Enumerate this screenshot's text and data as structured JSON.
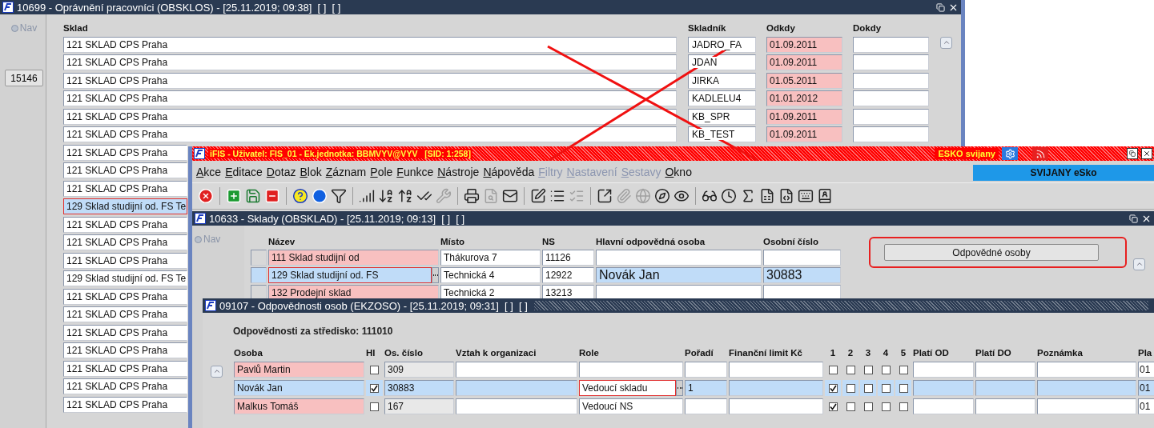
{
  "back_window": {
    "title": "10699 - Oprávnění pracovníci (OBSKLOS) - [25.11.2019; 09:38]  [ ]  [ ]",
    "nav": {
      "label": "Nav",
      "selected": false
    },
    "record_number": "15146",
    "columns": [
      "Sklad",
      "Skladník",
      "Odkdy",
      "Dokdy"
    ],
    "rows": [
      {
        "sklad": "121 SKLAD CPS Praha",
        "skladnik": "JADRO_FA",
        "odkdy": "01.09.2011",
        "selected": false
      },
      {
        "sklad": "121 SKLAD CPS Praha",
        "skladnik": "JDAN",
        "odkdy": "01.09.2011",
        "selected": false
      },
      {
        "sklad": "121 SKLAD CPS Praha",
        "skladnik": "JIRKA",
        "odkdy": "01.05.2011",
        "selected": false
      },
      {
        "sklad": "121 SKLAD CPS Praha",
        "skladnik": "KADLELU4",
        "odkdy": "01.01.2012",
        "selected": false
      },
      {
        "sklad": "121 SKLAD CPS Praha",
        "skladnik": "KB_SPR",
        "odkdy": "01.09.2011",
        "selected": false
      },
      {
        "sklad": "121 SKLAD CPS Praha",
        "skladnik": "KB_TEST",
        "odkdy": "01.09.2011",
        "selected": false
      },
      {
        "sklad": "121 SKLAD CPS Praha",
        "selected": false
      },
      {
        "sklad": "121 SKLAD CPS Praha",
        "selected": false
      },
      {
        "sklad": "121 SKLAD CPS Praha",
        "selected": false
      },
      {
        "sklad": "129 Sklad studijní od. FS Te",
        "selected": true
      },
      {
        "sklad": "121 SKLAD CPS Praha",
        "selected": false
      },
      {
        "sklad": "121 SKLAD CPS Praha",
        "selected": false
      },
      {
        "sklad": "121 SKLAD CPS Praha",
        "selected": false
      },
      {
        "sklad": "129 Sklad studijní od. FS Te",
        "selected": false
      },
      {
        "sklad": "121 SKLAD CPS Praha",
        "selected": false
      },
      {
        "sklad": "121 SKLAD CPS Praha",
        "selected": false
      },
      {
        "sklad": "121 SKLAD CPS Praha",
        "selected": false
      },
      {
        "sklad": "121 SKLAD CPS Praha",
        "selected": false
      },
      {
        "sklad": "121 SKLAD CPS Praha",
        "selected": false
      },
      {
        "sklad": "121 SKLAD CPS Praha",
        "selected": false
      },
      {
        "sklad": "121 SKLAD CPS Praha",
        "selected": false
      }
    ]
  },
  "main_window": {
    "title": "iFIS - Uživatel: FIS_01 - Ek.jednotka: BBMVYV@VYV   [SID: 1:258]",
    "badge": "ESKO svijany",
    "menu": [
      {
        "label": "Akce",
        "disabled": false
      },
      {
        "label": "Editace",
        "disabled": false
      },
      {
        "label": "Dotaz",
        "disabled": false
      },
      {
        "label": "Blok",
        "disabled": false
      },
      {
        "label": "Záznam",
        "disabled": false
      },
      {
        "label": "Pole",
        "disabled": false
      },
      {
        "label": "Funkce",
        "disabled": false
      },
      {
        "label": "Nástroje",
        "disabled": false
      },
      {
        "label": "Nápověda",
        "disabled": false
      },
      {
        "label": "Filtry",
        "disabled": true
      },
      {
        "label": "Nastavení",
        "disabled": true
      },
      {
        "label": "Sestavy",
        "disabled": true
      },
      {
        "label": "Okno",
        "disabled": false
      }
    ],
    "company": "SVIJANY eSko",
    "toolbar": [
      [
        {
          "disabled": false
        }
      ],
      [
        {
          "disabled": false
        },
        {
          "disabled": false
        },
        {
          "disabled": false
        }
      ],
      [
        {
          "disabled": false
        },
        {
          "disabled": false
        },
        {
          "disabled": false
        }
      ],
      [
        {
          "disabled": false
        },
        {
          "disabled": false
        },
        {
          "disabled": false
        },
        {
          "disabled": false
        },
        {
          "disabled": true
        }
      ],
      [
        {
          "disabled": false
        },
        {
          "disabled": true
        },
        {
          "disabled": false
        }
      ],
      [
        {
          "disabled": false
        },
        {
          "disabled": false
        },
        {
          "disabled": true
        }
      ],
      [
        {
          "disabled": false
        },
        {
          "disabled": true
        },
        {
          "disabled": true
        },
        {
          "disabled": false
        },
        {
          "disabled": false
        }
      ],
      [
        {
          "disabled": false
        },
        {
          "disabled": false
        },
        {
          "disabled": false
        },
        {
          "disabled": false
        },
        {
          "disabled": false
        },
        {
          "disabled": false
        },
        {
          "disabled": false
        }
      ]
    ]
  },
  "stores_window": {
    "title": "10633 - Sklady (OBSKLAD) - [25.11.2019; 09:13]  [ ]  [ ]",
    "nav": {
      "label": "Nav",
      "selected": false
    },
    "columns": [
      "Název",
      "Místo",
      "NS",
      "Hlavní odpovědná osoba",
      "Osobní číslo"
    ],
    "rows": [
      {
        "nazev": "111 Sklad studijní od",
        "misto": "Thákurova 7",
        "ns": "11126",
        "selected": false
      },
      {
        "nazev": "129 Sklad studijní od. FS",
        "misto": "Technická 4",
        "ns": "12922",
        "osoba": "Novák Jan",
        "cislo": "30883",
        "selected": true
      },
      {
        "nazev": "132 Prodejní sklad",
        "misto": "Technická 2",
        "ns": "13213",
        "selected": false
      }
    ],
    "button": "Odpovědné osoby"
  },
  "responsibility_window": {
    "title": "09107 - Odpovědnosti osob (EKZOSO) - [25.11.2019; 09:31]  [ ]  [ ]",
    "heading": "Odpovědnosti za středisko: 111010",
    "columns": [
      "Osoba",
      "Hl",
      "Os. číslo",
      "Vztah k organizaci",
      "Role",
      "Pořadí",
      "Finanční limit Kč",
      "1",
      "2",
      "3",
      "4",
      "5",
      "Platí OD",
      "Platí DO",
      "Poznámka",
      "Pla"
    ],
    "rows": [
      {
        "osoba": "Pavlů Martin",
        "hl": false,
        "cislo": "309",
        "flags": [
          false,
          false,
          false,
          false,
          false
        ],
        "column_16": "01",
        "selected": false
      },
      {
        "osoba": "Novák Jan",
        "hl": true,
        "cislo": "30883",
        "role": "Vedoucí skladu",
        "poradi": "1",
        "flags": [
          true,
          false,
          false,
          false,
          false
        ],
        "column_16": "01",
        "selected": true
      },
      {
        "osoba": "Malkus Tomáš",
        "hl": false,
        "cislo": "167",
        "role": "Vedoucí NS",
        "flags": [
          true,
          false,
          false,
          false,
          false
        ],
        "column_16": "01",
        "selected": false
      }
    ]
  }
}
